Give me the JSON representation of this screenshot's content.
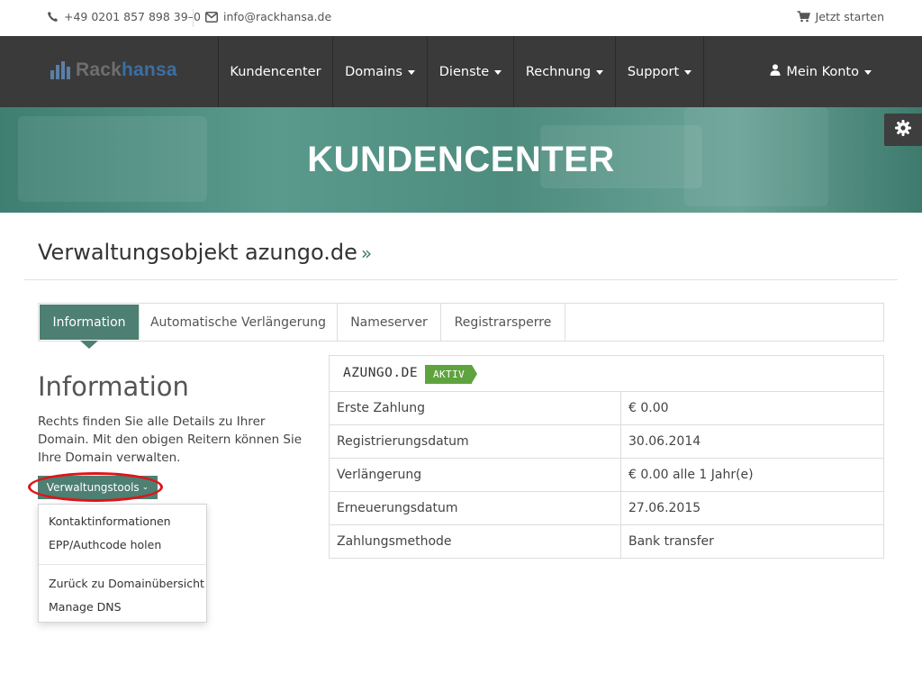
{
  "topbar": {
    "phone": "+49 0201 857 898 39–0",
    "email": "info@rackhansa.de",
    "start": "Jetzt starten"
  },
  "brand": {
    "part1": "Rack",
    "part2": "hansa",
    "color_dark": "#3a3a3a",
    "color_accent": "#3c6fa3"
  },
  "nav": {
    "items": [
      {
        "label": "Kundencenter",
        "has_caret": false
      },
      {
        "label": "Domains",
        "has_caret": true
      },
      {
        "label": "Dienste",
        "has_caret": true
      },
      {
        "label": "Rechnung",
        "has_caret": true
      },
      {
        "label": "Support",
        "has_caret": true
      }
    ],
    "account_label": "Mein Konto"
  },
  "banner": {
    "title": "KUNDENCENTER",
    "color": "#4d8c7e"
  },
  "page": {
    "title": "Verwaltungsobjekt azungo.de",
    "title_suffix": "»"
  },
  "tabs": [
    {
      "label": "Information",
      "active": true
    },
    {
      "label": "Automatische Verlängerung",
      "active": false
    },
    {
      "label": "Nameserver",
      "active": false
    },
    {
      "label": "Registrarsperre",
      "active": false
    }
  ],
  "info": {
    "heading": "Information",
    "text": "Rechts finden Sie alle Details zu Ihrer Domain. Mit den obigen Reitern können Sie Ihre Domain verwalten.",
    "tools_label": "Verwaltungstools",
    "tools_chevron": "⌄"
  },
  "dropdown": {
    "items": [
      "Kontaktinformationen",
      "EPP/Authcode holen",
      "Zurück zu Domainübersicht",
      "Manage DNS"
    ]
  },
  "domain": {
    "name": "AZUNGO.DE",
    "status": "AKTIV",
    "status_color": "#5fa33f",
    "rows": [
      {
        "key": "Erste Zahlung",
        "value": "€ 0.00"
      },
      {
        "key": "Registrierungsdatum",
        "value": "30.06.2014"
      },
      {
        "key": "Verlängerung",
        "value": "€ 0.00 alle 1 Jahr(e)"
      },
      {
        "key": "Erneuerungsdatum",
        "value": "27.06.2015"
      },
      {
        "key": "Zahlungsmethode",
        "value": "Bank transfer"
      }
    ]
  },
  "colors": {
    "primary": "#4d7f72",
    "highlight": "#e0141a"
  }
}
